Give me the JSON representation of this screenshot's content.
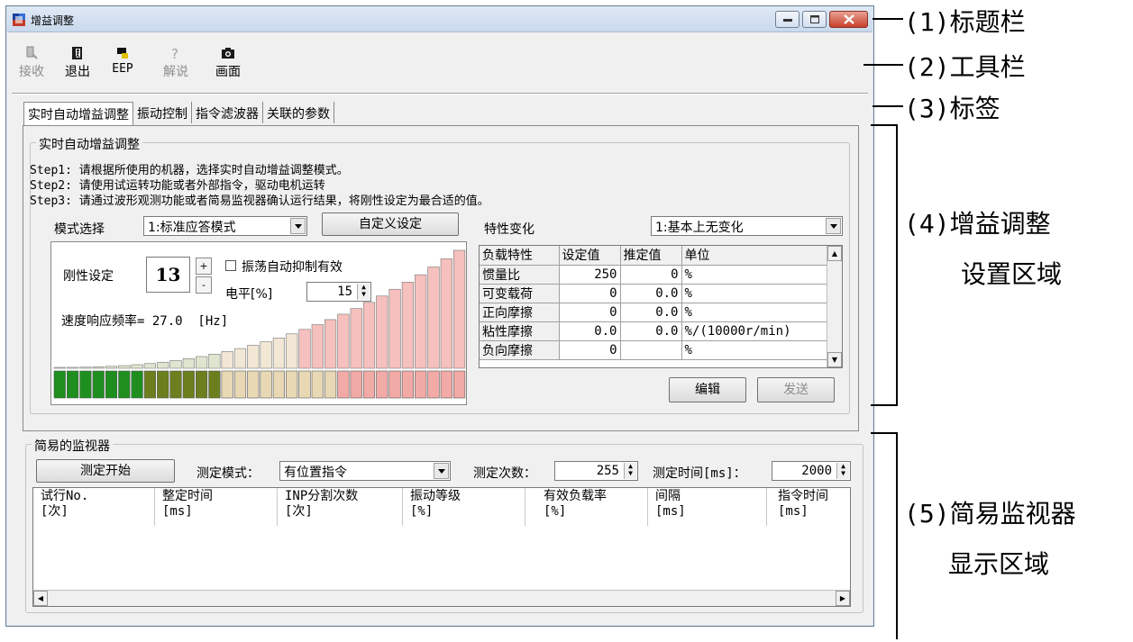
{
  "window": {
    "title": "增益调整",
    "controls": {
      "minimize": "minimize",
      "maximize": "maximize",
      "close": "close"
    }
  },
  "toolbar": {
    "receive": "接收",
    "exit": "退出",
    "eep": "EEP",
    "explain": "解说",
    "screen": "画面"
  },
  "tabs": [
    "实时自动增益调整",
    "振动控制",
    "指令滤波器",
    "关联的参数"
  ],
  "gain": {
    "group_title": "实时自动增益调整",
    "steps": [
      "Step1: 请根据所使用的机器，选择实时自动增益调整模式。",
      "Step2: 请使用试运转功能或者外部指令，驱动电机运转",
      "Step3: 请通过波形观测功能或者简易监视器确认运行结果，将刚性设定为最合适的值。"
    ],
    "mode_label": "模式选择",
    "mode_value": "1:标准应答模式",
    "custom_button": "自定义设定",
    "char_label": "特性变化",
    "char_value": "1:基本上无变化",
    "stiffness_label": "刚性设定",
    "stiffness_value": "13",
    "stiffness_max": 32,
    "spin_up": "+",
    "spin_down": "-",
    "vib_check_label": "振荡自动抑制有效",
    "level_label": "电平[%]",
    "level_value": "15",
    "freq_text": "速度响应频率= 27.0  [Hz]",
    "table": {
      "headers": [
        "负载特性",
        "设定值",
        "推定值",
        "单位"
      ],
      "rows": [
        [
          "惯量比",
          "250",
          "0",
          "%"
        ],
        [
          "可变载荷",
          "0",
          "0.0",
          "%"
        ],
        [
          "正向摩擦",
          "0",
          "0.0",
          "%"
        ],
        [
          "粘性摩擦",
          "0.0",
          "0.0",
          "%/(10000r/min)"
        ],
        [
          "负向摩擦",
          "0",
          "",
          "%"
        ]
      ]
    },
    "edit_button": "编辑",
    "send_button": "发送"
  },
  "monitor": {
    "group_title": "简易的监视器",
    "start_button": "测定开始",
    "mode_label": "测定模式：",
    "mode_value": "有位置指令",
    "count_label": "测定次数：",
    "count_value": "255",
    "time_label": "测定时间[ms]：",
    "time_value": "2000",
    "columns": [
      [
        "试行No.",
        "[次]"
      ],
      [
        "整定时间",
        "[ms]"
      ],
      [
        "INP分割次数",
        "[次]"
      ],
      [
        "振动等级",
        "[%]"
      ],
      [
        "有效负载率",
        "[%]"
      ],
      [
        "间隔",
        "[ms]"
      ],
      [
        "指令时间",
        "[ms]"
      ]
    ]
  },
  "annotations": {
    "a1": "(1)标题栏",
    "a2": "(2)工具栏",
    "a3": "(3)标签",
    "a4_line1": "(4)增益调整",
    "a4_line2": "设置区域",
    "a5_line1": "(5)简易监视器",
    "a5_line2": "显示区域"
  },
  "colors": {
    "bar_active_dark": "#1e8f1e",
    "bar_active_olive": "#6b7f1e",
    "bar_inactive_light": "#e8d8b4",
    "bar_inactive_pink": "#f2aaa6"
  }
}
